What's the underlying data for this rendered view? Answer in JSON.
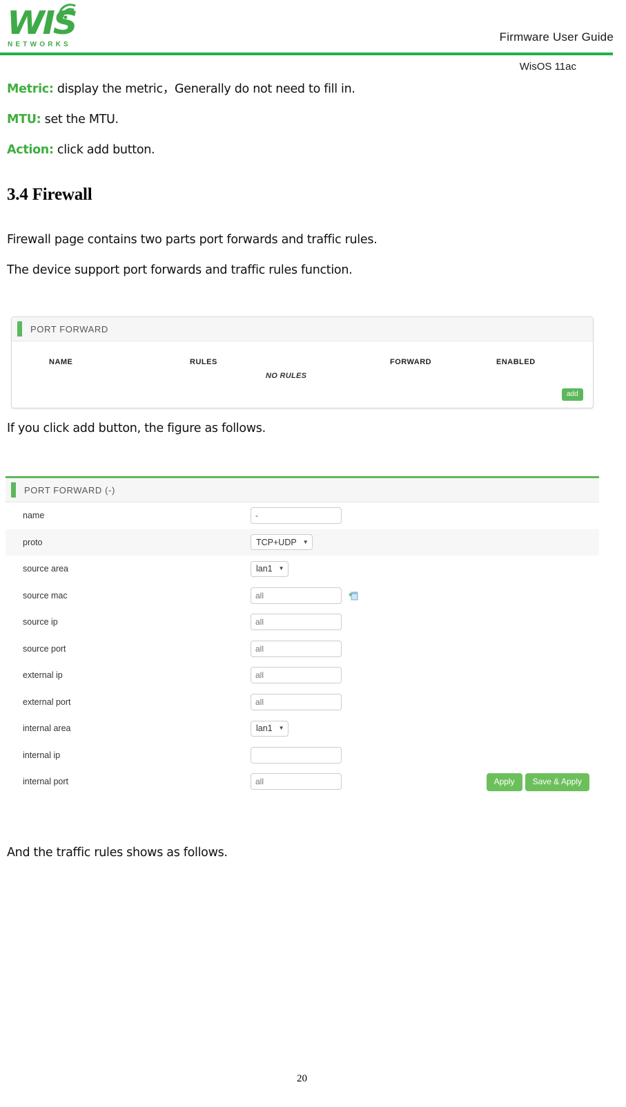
{
  "header": {
    "logo_text": "WIS",
    "logo_subtext": "NETWORKS",
    "logo_icon": "wifi-signal-icon",
    "title": "Firmware User Guide",
    "subtitle": "WisOS 11ac",
    "rule_color": "#22b14c",
    "brand_color": "#3faa49"
  },
  "body": {
    "definitions": [
      {
        "label": "Metric:",
        "text": " display the metric，Generally do not need to fill in."
      },
      {
        "label": "MTU:",
        "text": " set the MTU."
      },
      {
        "label": "Action:",
        "text": " click add button."
      }
    ],
    "section_heading": "3.4 Firewall",
    "intro_line_1": "Firewall page contains two parts port forwards and traffic rules.",
    "intro_line_2": "The device support port forwards and traffic rules function.",
    "caption_after_list": "If you click add button, the figure as follows.",
    "caption_after_form": "And the traffic rules shows as follows."
  },
  "port_forward_list": {
    "panel_title": "PORT FORWARD",
    "columns": [
      "NAME",
      "RULES",
      "FORWARD",
      "ENABLED"
    ],
    "empty_text": "NO RULES",
    "add_button": "add"
  },
  "port_forward_form": {
    "panel_title": "PORT FORWARD (-)",
    "rows": [
      {
        "label": "name",
        "type": "text",
        "value": "-",
        "placeholder": ""
      },
      {
        "label": "proto",
        "type": "select",
        "value": "TCP+UDP"
      },
      {
        "label": "source area",
        "type": "select",
        "value": "lan1"
      },
      {
        "label": "source mac",
        "type": "text",
        "value": "",
        "placeholder": "all",
        "icon": "add-entry-icon"
      },
      {
        "label": "source ip",
        "type": "text",
        "value": "",
        "placeholder": "all"
      },
      {
        "label": "source port",
        "type": "text",
        "value": "",
        "placeholder": "all"
      },
      {
        "label": "external ip",
        "type": "text",
        "value": "",
        "placeholder": "all"
      },
      {
        "label": "external port",
        "type": "text",
        "value": "",
        "placeholder": "all"
      },
      {
        "label": "internal area",
        "type": "select",
        "value": "lan1"
      },
      {
        "label": "internal ip",
        "type": "text",
        "value": "",
        "placeholder": ""
      },
      {
        "label": "internal port",
        "type": "text",
        "value": "",
        "placeholder": "all"
      }
    ],
    "apply_button": "Apply",
    "save_apply_button": "Save & Apply",
    "button_color": "#6cbf5b"
  },
  "footer": {
    "page_number": "20"
  }
}
